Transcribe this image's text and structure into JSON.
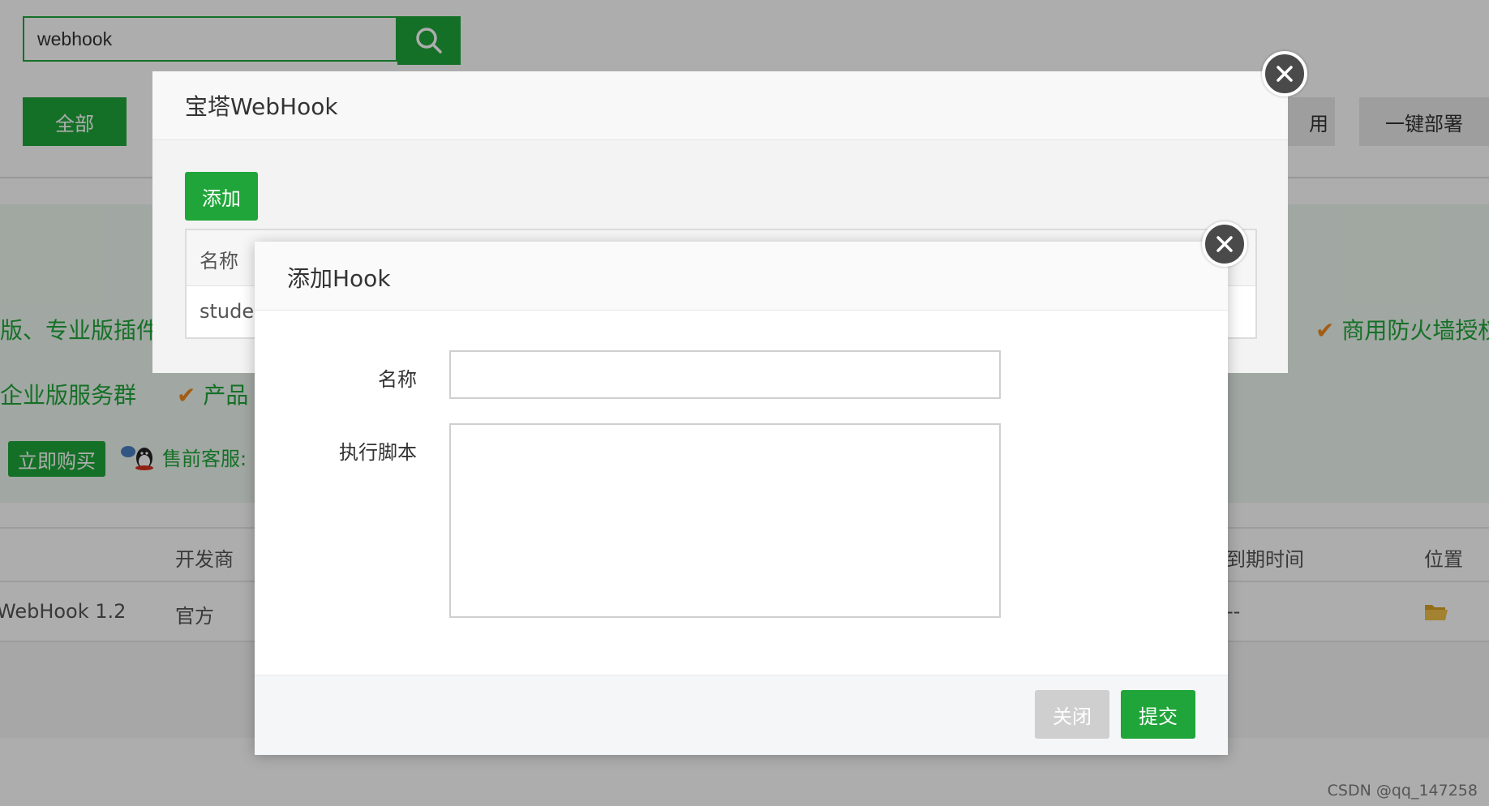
{
  "search": {
    "value": "webhook"
  },
  "categories": {
    "all_label": "全部",
    "partial_label": "用",
    "deploy_label": "一键部署"
  },
  "promo": {
    "line1_left": "版、专业版插件",
    "line1_right": "商用防火墙授权",
    "line2_left": "企业版服务群",
    "line2_mid": "产品",
    "buy_label": "立即购买",
    "service_label": "售前客服: "
  },
  "plugin_table": {
    "headers": {
      "developer": "开发商",
      "expiry": "到期时间",
      "location": "位置"
    },
    "row": {
      "name": "WebHook 1.2",
      "developer": "官方",
      "expiry": "--"
    }
  },
  "webhook_dialog": {
    "title": "宝塔WebHook",
    "add_label": "添加",
    "table_header_name": "名称",
    "table_row_name": "studer"
  },
  "add_hook_dialog": {
    "title": "添加Hook",
    "name_label": "名称",
    "script_label": "执行脚本",
    "name_value": "",
    "script_value": "",
    "close_label": "关闭",
    "submit_label": "提交"
  },
  "colors": {
    "brand_green": "#20a53a",
    "check_orange": "#f0891e"
  },
  "watermark": "CSDN @qq_147258"
}
